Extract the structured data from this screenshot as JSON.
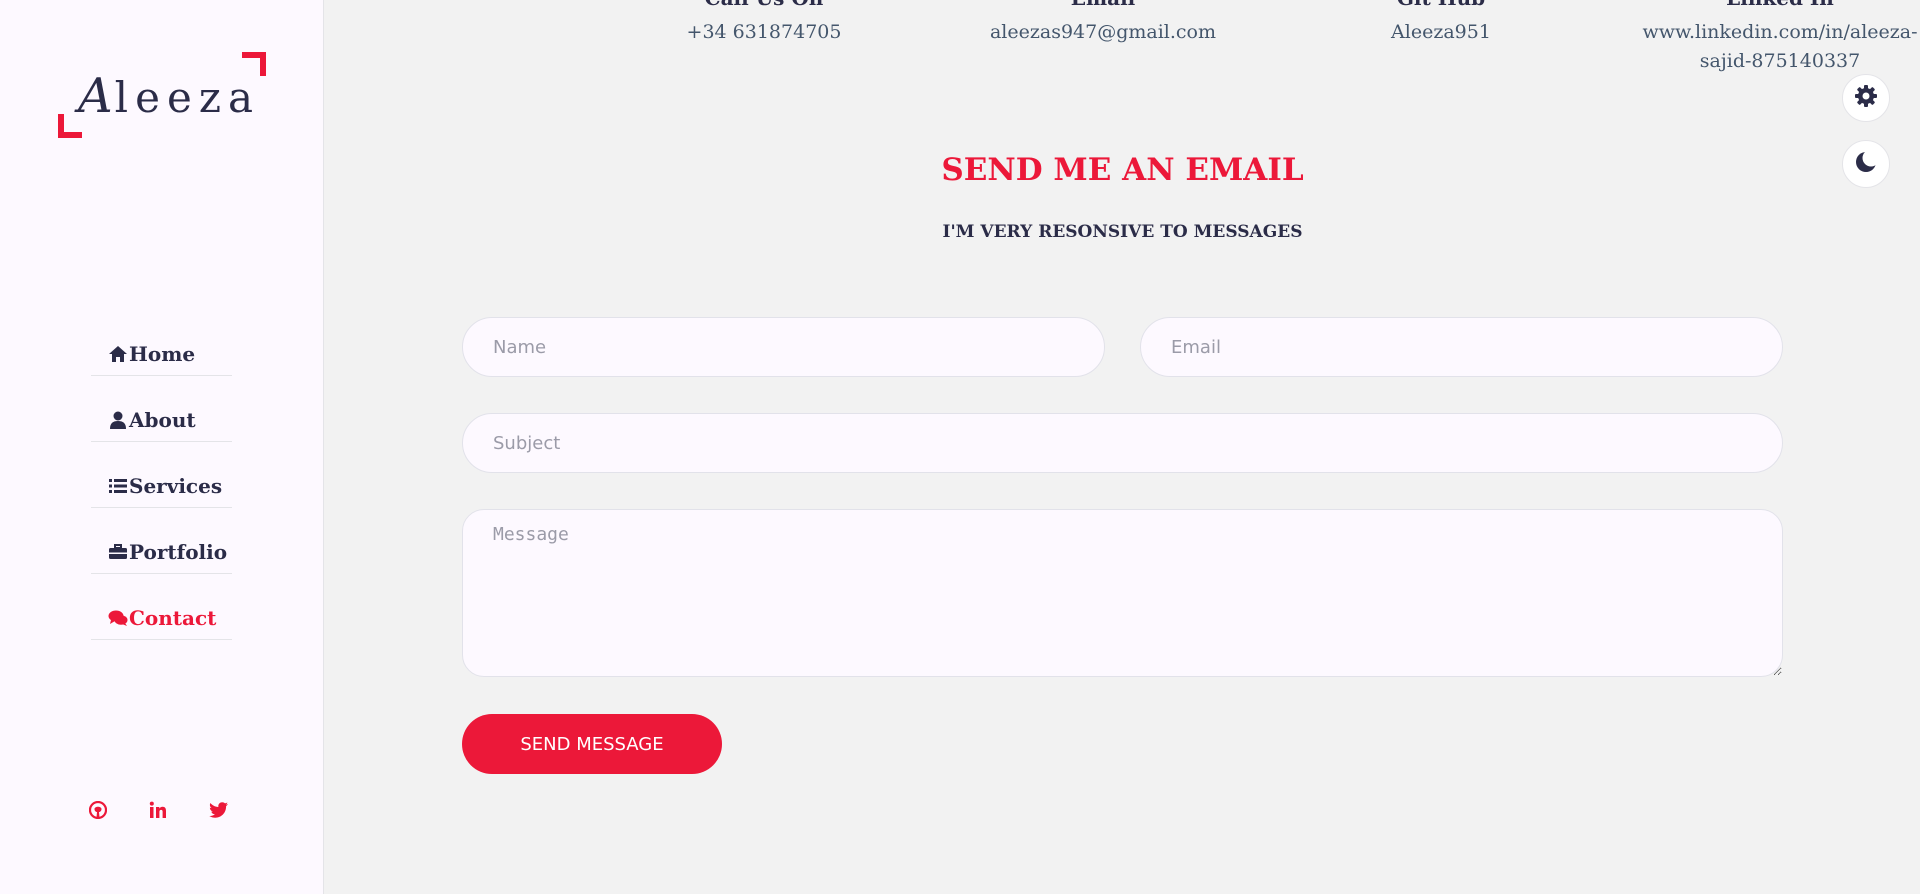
{
  "brand": {
    "logo_text_first": "A",
    "logo_text_rest": "leeza"
  },
  "nav": {
    "items": [
      {
        "label": "Home",
        "icon": "home-icon"
      },
      {
        "label": "About",
        "icon": "user-icon"
      },
      {
        "label": "Services",
        "icon": "list-icon"
      },
      {
        "label": "Portfolio",
        "icon": "briefcase-icon"
      },
      {
        "label": "Contact",
        "icon": "comments-icon",
        "active": true
      }
    ]
  },
  "socials": [
    "github-icon",
    "linkedin-icon",
    "twitter-icon"
  ],
  "contact_info": [
    {
      "title": "Call Us On",
      "value": "+34 631874705"
    },
    {
      "title": "Email",
      "value": "aleezas947@gmail.com"
    },
    {
      "title": "Git Hub",
      "value": "Aleeza951"
    },
    {
      "title": "Linked In",
      "value_line1": "www.linkedin.com/in/aleeza-",
      "value_line2": "sajid-875140337"
    }
  ],
  "form": {
    "title": "SEND ME AN EMAIL",
    "subtitle": "I'M VERY RESONSIVE TO MESSAGES",
    "name_placeholder": "Name",
    "email_placeholder": "Email",
    "subject_placeholder": "Subject",
    "message_placeholder": "Message",
    "submit_label": "SEND MESSAGE"
  },
  "colors": {
    "accent": "#ec1839",
    "text_dark": "#2b2c48",
    "sidebar_bg": "#fdf9ff",
    "main_bg": "#f2f2f2"
  }
}
